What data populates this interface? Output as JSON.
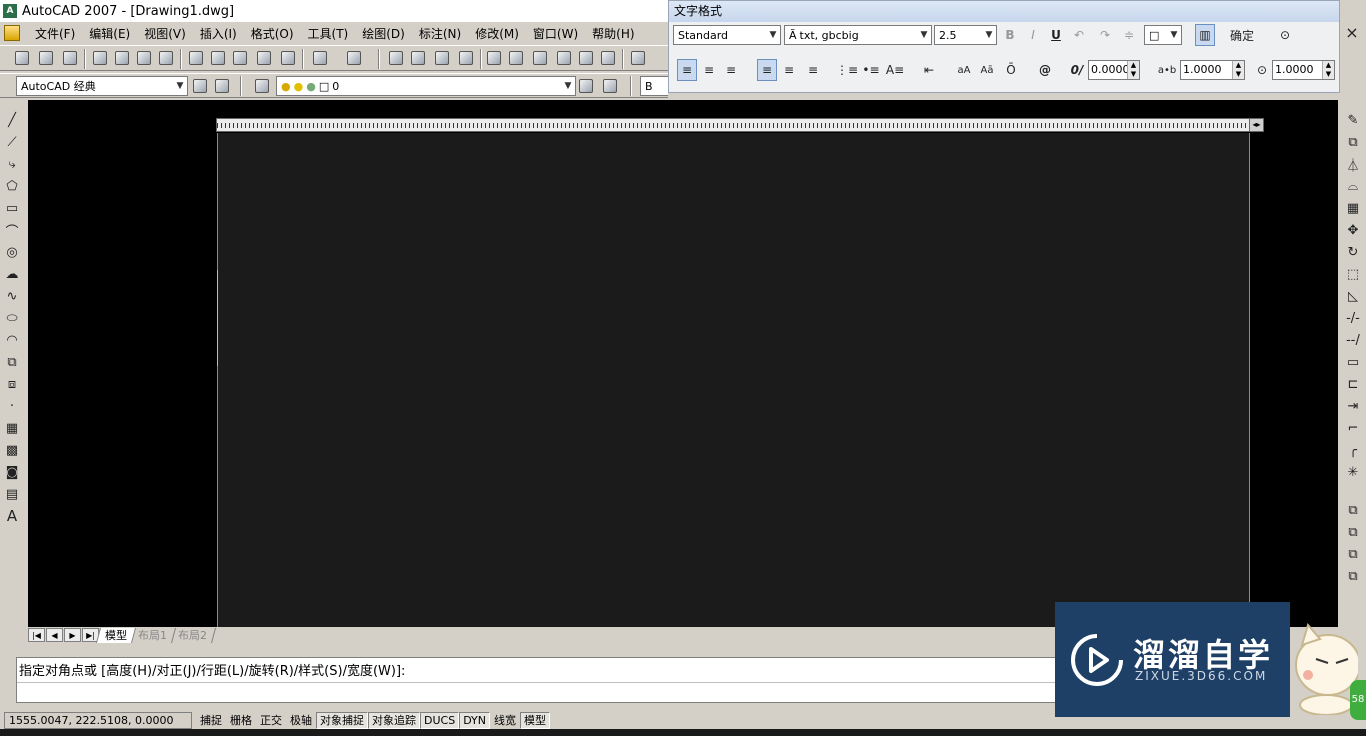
{
  "window": {
    "title": "AutoCAD 2007 - [Drawing1.dwg]",
    "close_glyph": "×"
  },
  "menu": [
    "文件(F)",
    "编辑(E)",
    "视图(V)",
    "插入(I)",
    "格式(O)",
    "工具(T)",
    "绘图(D)",
    "标注(N)",
    "修改(M)",
    "窗口(W)",
    "帮助(H)"
  ],
  "workspace": {
    "value": "AutoCAD 经典"
  },
  "layer": {
    "value": "0"
  },
  "bylayer_partial": "B",
  "text_format": {
    "title": "文字格式",
    "style": "Standard",
    "font": "txt, gbcbig",
    "height": "2.5",
    "ok_label": "确定",
    "oblique": "0.0000",
    "tracking": "1.0000",
    "width_factor": "1.0000",
    "buttons": {
      "bold": "B",
      "italic": "I",
      "underline": "U",
      "at": "@",
      "oblique_icon": "0/",
      "tracking_icon": "a•b",
      "upper": "ā",
      "caps": "aA",
      "capsA": "Aā",
      "overline": "Ō"
    }
  },
  "icons": {
    "ruler_end": "◂▸",
    "text_tool": "A"
  },
  "layout_tabs": [
    "模型",
    "布局1",
    "布局2"
  ],
  "command": {
    "line": "指定对角点或 [高度(H)/对正(J)/行距(L)/旋转(R)/样式(S)/宽度(W)]:"
  },
  "status": {
    "coords": "1555.0047, 222.5108, 0.0000",
    "buttons": [
      {
        "label": "捕捉",
        "on": false
      },
      {
        "label": "栅格",
        "on": false
      },
      {
        "label": "正交",
        "on": false
      },
      {
        "label": "极轴",
        "on": false
      },
      {
        "label": "对象捕捉",
        "on": true
      },
      {
        "label": "对象追踪",
        "on": true
      },
      {
        "label": "DUCS",
        "on": true
      },
      {
        "label": "DYN",
        "on": true
      },
      {
        "label": "线宽",
        "on": false
      },
      {
        "label": "模型",
        "on": true
      }
    ]
  },
  "watermark": {
    "title": "溜溜自学",
    "subtitle": "ZIXUE.3D66.COM"
  },
  "badge": "58",
  "colors": {
    "canvas": "#000000",
    "editor": "#1b1b1b",
    "watermark_bg": "#1e3f66",
    "panel_header": "#c6d6ec"
  }
}
